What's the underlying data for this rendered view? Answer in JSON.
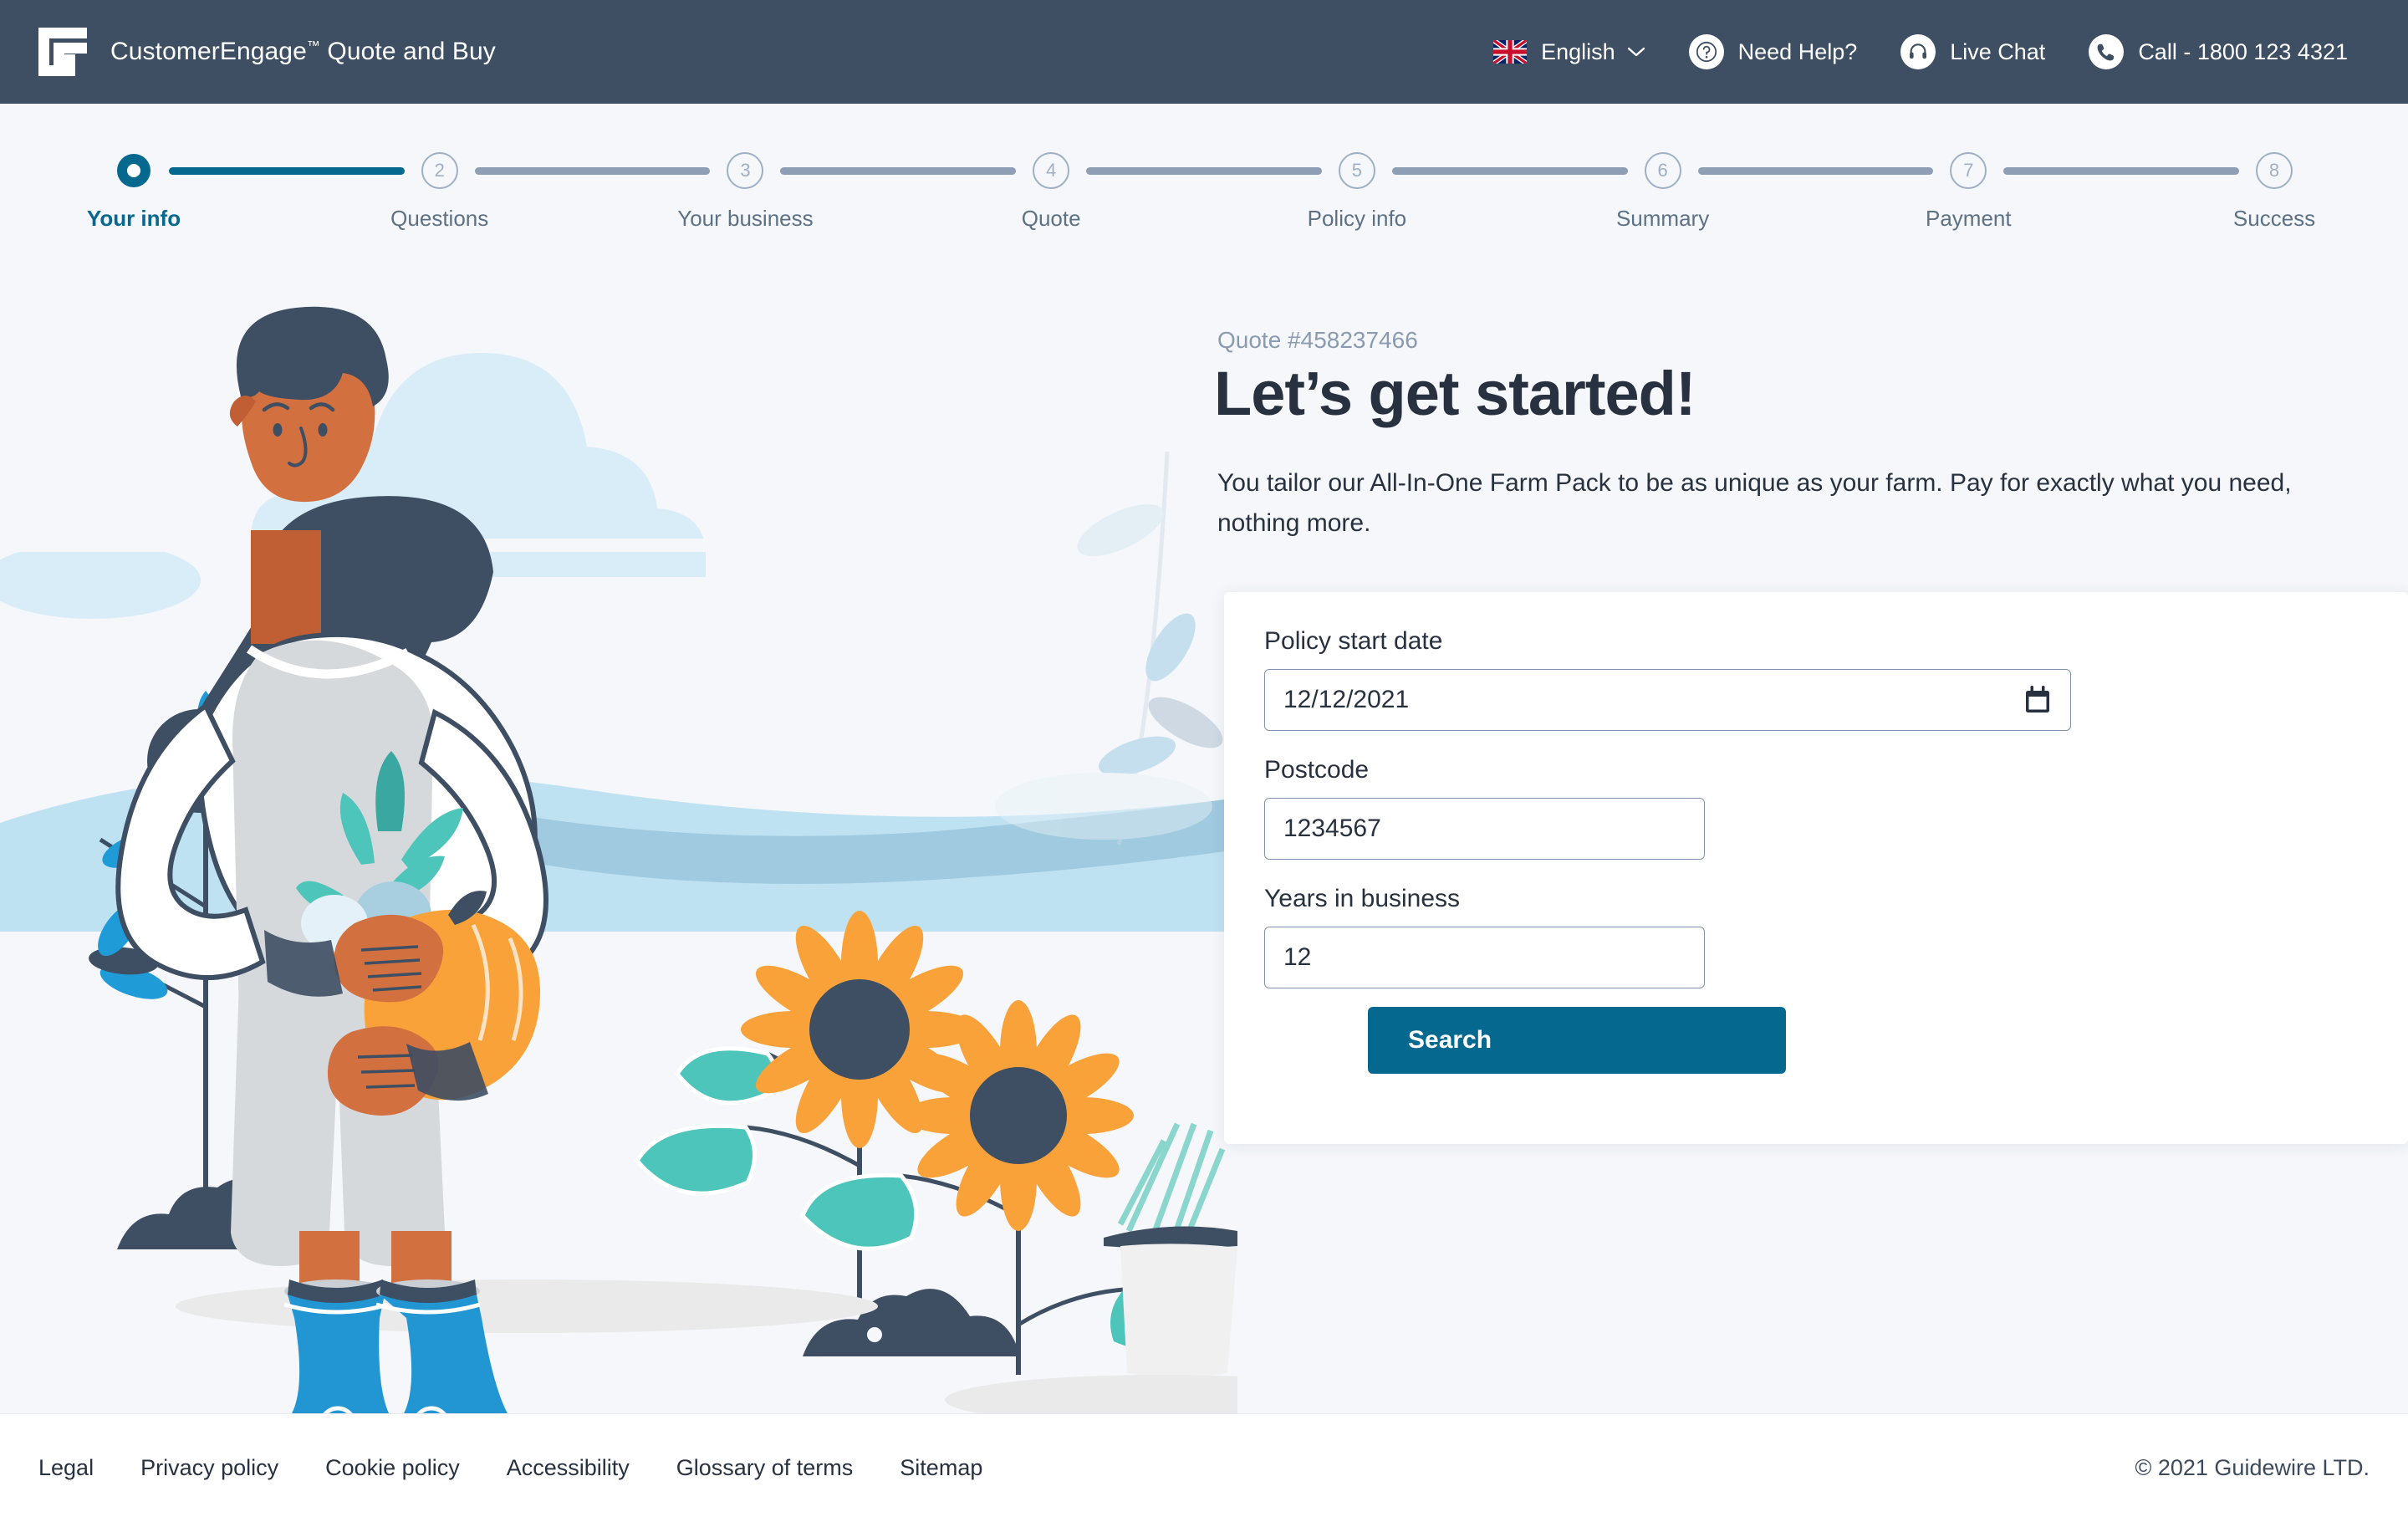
{
  "header": {
    "logo_icon": "guidewire-g-logo",
    "brand_name": "CustomerEngage",
    "brand_tm": "™",
    "brand_suffix": " Quote and Buy",
    "nav": {
      "language": {
        "label": "English",
        "flag_icon": "uk-flag-icon",
        "chevron_icon": "chevron-down-icon"
      },
      "help": {
        "label": "Need Help?",
        "icon": "question-mark-icon"
      },
      "chat": {
        "label": "Live Chat",
        "icon": "headset-icon"
      },
      "call": {
        "label": "Call - 1800 123 4321",
        "icon": "phone-icon"
      }
    },
    "background_color": "#3e4e63"
  },
  "stepper": {
    "active_index": 0,
    "accent_color": "#05688f",
    "inactive_color": "#8e9fb5",
    "steps": [
      {
        "num": "1",
        "label": "Your info"
      },
      {
        "num": "2",
        "label": "Questions"
      },
      {
        "num": "3",
        "label": "Your business"
      },
      {
        "num": "4",
        "label": "Quote"
      },
      {
        "num": "5",
        "label": "Policy info"
      },
      {
        "num": "6",
        "label": "Summary"
      },
      {
        "num": "7",
        "label": "Payment"
      },
      {
        "num": "8",
        "label": "Success"
      }
    ]
  },
  "main": {
    "quote_number": "Quote #458237466",
    "headline": "Let’s get started!",
    "subline": "You tailor our All-In-One Farm Pack to be as unique as your farm. Pay for exactly what you need, nothing more.",
    "form": {
      "policy_start_date": {
        "label": "Policy start date",
        "value": "12/12/2021",
        "icon": "calendar-icon"
      },
      "postcode": {
        "label": "Postcode",
        "value": "1234567"
      },
      "years_in_business": {
        "label": "Years in business",
        "value": "12"
      },
      "submit_label": "Search",
      "submit_color": "#05688f"
    }
  },
  "illustration": {
    "name": "farmer-woman-with-vegetables-and-sunflowers",
    "colors": {
      "sky": "#d9edf8",
      "ground": "#bfe2f3",
      "ground_dark": "#8fbdd4",
      "skin": "#d2703f",
      "hair": "#3e4e63",
      "shirt": "#ffffff",
      "overalls": "#d6d9dc",
      "boots": "#2196d3",
      "petals": "#f9a23a",
      "leaf": "#4ec5bb",
      "leaf_blue": "#1f9cd8"
    }
  },
  "footer": {
    "links": [
      "Legal",
      "Privacy policy",
      "Cookie policy",
      "Accessibility",
      "Glossary of terms",
      "Sitemap"
    ],
    "copyright": "© 2021 Guidewire LTD."
  }
}
